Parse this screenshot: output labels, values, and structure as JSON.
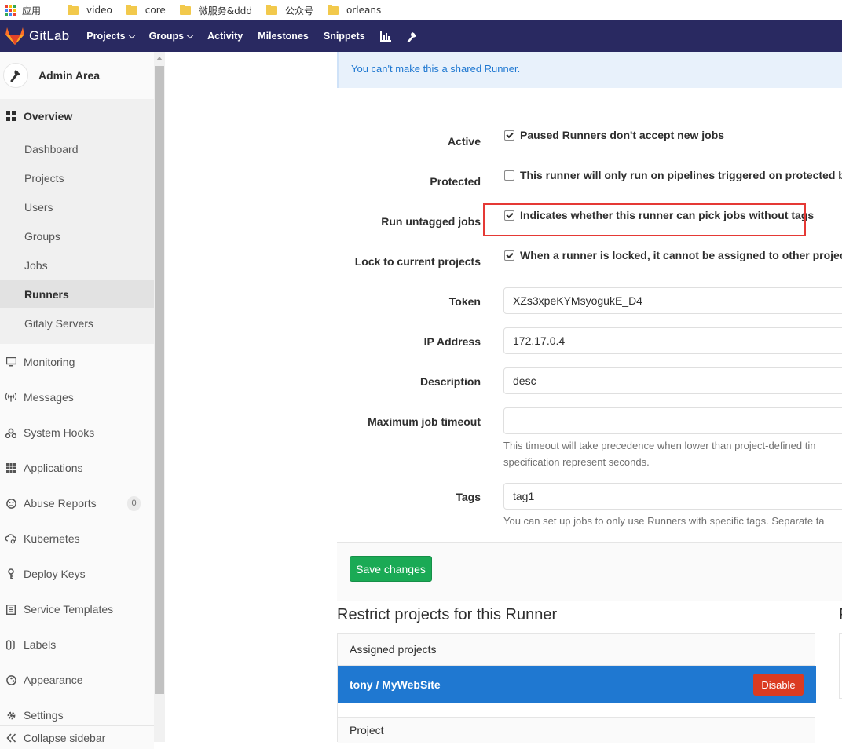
{
  "bookmarks": [
    {
      "label": "应用",
      "icon": "apps-grid-icon"
    },
    {
      "label": "video",
      "icon": "folder-icon"
    },
    {
      "label": "core",
      "icon": "folder-icon"
    },
    {
      "label": "微服务&ddd",
      "icon": "folder-icon"
    },
    {
      "label": "公众号",
      "icon": "folder-icon"
    },
    {
      "label": "orleans",
      "icon": "folder-icon"
    }
  ],
  "header": {
    "logo_text": "GitLab",
    "nav": [
      {
        "label": "Projects",
        "dropdown": true
      },
      {
        "label": "Groups",
        "dropdown": true
      },
      {
        "label": "Activity",
        "dropdown": false
      },
      {
        "label": "Milestones",
        "dropdown": false
      },
      {
        "label": "Snippets",
        "dropdown": false
      }
    ],
    "colors": {
      "background": "#292961",
      "brand": "#fc6d26"
    }
  },
  "sidebar": {
    "title": "Admin Area",
    "overview_label": "Overview",
    "overview_items": [
      "Dashboard",
      "Projects",
      "Users",
      "Groups",
      "Jobs",
      "Runners",
      "Gitaly Servers"
    ],
    "active_item": "Runners",
    "items": [
      {
        "label": "Monitoring",
        "icon": "monitor-icon"
      },
      {
        "label": "Messages",
        "icon": "broadcast-icon"
      },
      {
        "label": "System Hooks",
        "icon": "hook-icon"
      },
      {
        "label": "Applications",
        "icon": "applications-icon"
      },
      {
        "label": "Abuse Reports",
        "icon": "abuse-icon",
        "badge": "0"
      },
      {
        "label": "Kubernetes",
        "icon": "cloud-gear-icon"
      },
      {
        "label": "Deploy Keys",
        "icon": "key-icon"
      },
      {
        "label": "Service Templates",
        "icon": "template-icon"
      },
      {
        "label": "Labels",
        "icon": "labels-icon"
      },
      {
        "label": "Appearance",
        "icon": "palette-icon"
      },
      {
        "label": "Settings",
        "icon": "gear-icon"
      }
    ],
    "collapse_label": "Collapse sidebar"
  },
  "alert": {
    "text": "You can't make this a shared Runner."
  },
  "form": {
    "active": {
      "label": "Active",
      "text": "Paused Runners don't accept new jobs",
      "checked": true
    },
    "protected": {
      "label": "Protected",
      "text": "This runner will only run on pipelines triggered on protected bra",
      "checked": false
    },
    "untagged": {
      "label": "Run untagged jobs",
      "text": "Indicates whether this runner can pick jobs without tags",
      "checked": true
    },
    "locked": {
      "label": "Lock to current projects",
      "text": "When a runner is locked, it cannot be assigned to other projects",
      "checked": true
    },
    "token": {
      "label": "Token",
      "value": "XZs3xpeKYMsyogukE_D4"
    },
    "ip": {
      "label": "IP Address",
      "value": "172.17.0.4"
    },
    "description": {
      "label": "Description",
      "value": "desc"
    },
    "timeout": {
      "label": "Maximum job timeout",
      "value": "",
      "help_line1": "This timeout will take precedence when lower than project-defined tin",
      "help_line2": "specification represent seconds."
    },
    "tags": {
      "label": "Tags",
      "value": "tag1",
      "help": "You can set up jobs to only use Runners with specific tags. Separate ta"
    },
    "save_label": "Save changes"
  },
  "restrict": {
    "title": "Restrict projects for this Runner",
    "assigned_header": "Assigned projects",
    "project_name": "tony / MyWebSite",
    "disable_label": "Disable",
    "project_header": "Project",
    "right_title": "F"
  }
}
